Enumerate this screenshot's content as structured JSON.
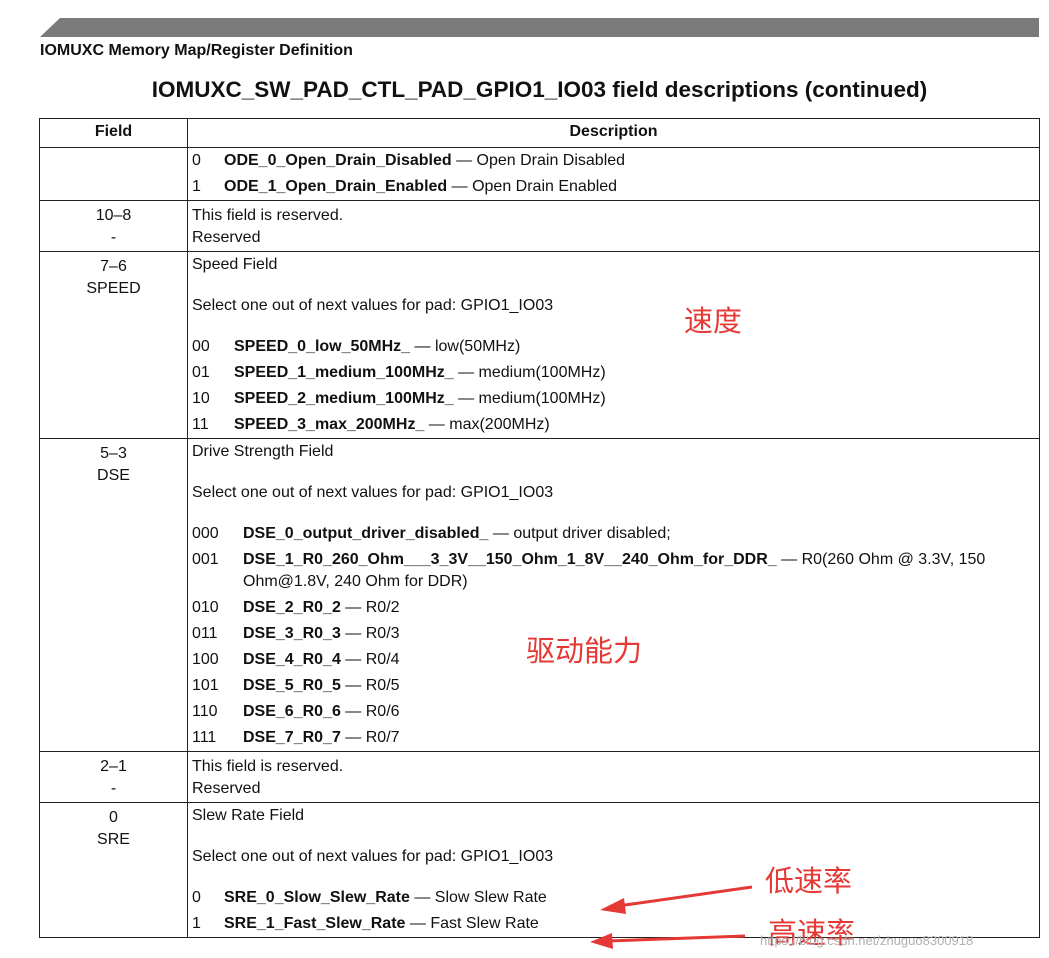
{
  "section_title": "IOMUXC Memory Map/Register Definition",
  "table_title": "IOMUXC_SW_PAD_CTL_PAD_GPIO1_IO03 field descriptions (continued)",
  "headers": {
    "field": "Field",
    "description": "Description"
  },
  "ode": {
    "e0_code": "0",
    "e0_name": "ODE_0_Open_Drain_Disabled",
    "e0_desc": " — Open Drain Disabled",
    "e1_code": "1",
    "e1_name": "ODE_1_Open_Drain_Enabled",
    "e1_desc": " — Open Drain Enabled"
  },
  "reserved1": {
    "bits": "10–8",
    "name": "-",
    "line1": "This field is reserved.",
    "line2": "Reserved"
  },
  "speed": {
    "bits": "7–6",
    "name": "SPEED",
    "title": "Speed Field",
    "select": "Select one out of next values for pad: GPIO1_IO03",
    "e0_code": "00",
    "e0_name": "SPEED_0_low_50MHz_",
    "e0_desc": " — low(50MHz)",
    "e1_code": "01",
    "e1_name": "SPEED_1_medium_100MHz_",
    "e1_desc": " — medium(100MHz)",
    "e2_code": "10",
    "e2_name": "SPEED_2_medium_100MHz_",
    "e2_desc": " — medium(100MHz)",
    "e3_code": "11",
    "e3_name": "SPEED_3_max_200MHz_",
    "e3_desc": " — max(200MHz)"
  },
  "dse": {
    "bits": "5–3",
    "name": "DSE",
    "title": "Drive Strength Field",
    "select": "Select one out of next values for pad: GPIO1_IO03",
    "e0_code": "000",
    "e0_name": "DSE_0_output_driver_disabled_",
    "e0_desc": " — output driver disabled;",
    "e1_code": "001",
    "e1_name": "DSE_1_R0_260_Ohm___3_3V__150_Ohm_1_8V__240_Ohm_for_DDR_",
    "e1_desc": " — R0(260 Ohm @ 3.3V, 150 Ohm@1.8V, 240 Ohm for DDR)",
    "e2_code": "010",
    "e2_name": "DSE_2_R0_2",
    "e2_desc": " — R0/2",
    "e3_code": "011",
    "e3_name": "DSE_3_R0_3",
    "e3_desc": " — R0/3",
    "e4_code": "100",
    "e4_name": "DSE_4_R0_4",
    "e4_desc": " — R0/4",
    "e5_code": "101",
    "e5_name": "DSE_5_R0_5",
    "e5_desc": " — R0/5",
    "e6_code": "110",
    "e6_name": "DSE_6_R0_6",
    "e6_desc": " — R0/6",
    "e7_code": "111",
    "e7_name": "DSE_7_R0_7",
    "e7_desc": " — R0/7"
  },
  "reserved2": {
    "bits": "2–1",
    "name": "-",
    "line1": "This field is reserved.",
    "line2": "Reserved"
  },
  "sre": {
    "bits": "0",
    "name": "SRE",
    "title": "Slew Rate Field",
    "select": "Select one out of next values for pad: GPIO1_IO03",
    "e0_code": "0",
    "e0_name": "SRE_0_Slow_Slew_Rate",
    "e0_desc": " — Slow Slew Rate",
    "e1_code": "1",
    "e1_name": "SRE_1_Fast_Slew_Rate",
    "e1_desc": " — Fast Slew Rate"
  },
  "annotations": {
    "speed": "速度",
    "dse": "驱动能力",
    "slow": "低速率",
    "fast": "高速率",
    "color": "#e53935"
  },
  "watermark": "https://blog.csdn.net/zhuguo8300918"
}
